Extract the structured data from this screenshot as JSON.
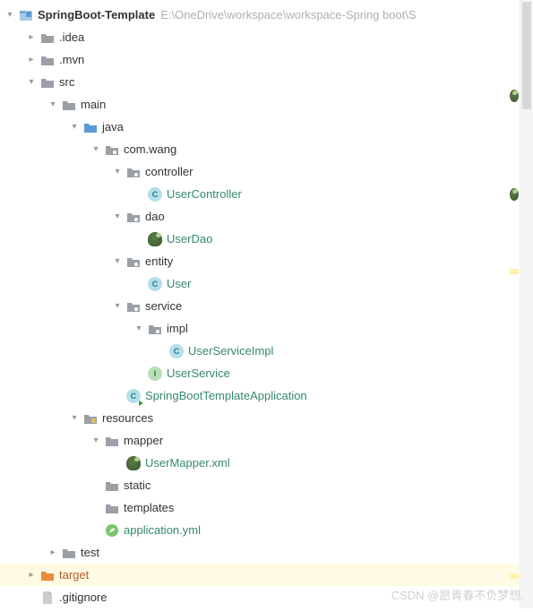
{
  "root": {
    "name": "SpringBoot-Template",
    "path": "E:\\OneDrive\\workspace\\workspace-Spring boot\\S"
  },
  "tree": {
    "idea": ".idea",
    "mvn": ".mvn",
    "src": "src",
    "main": "main",
    "java": "java",
    "pkg": "com.wang",
    "controller": "controller",
    "usercontroller": "UserController",
    "dao": "dao",
    "userdao": "UserDao",
    "entity": "entity",
    "user": "User",
    "service": "service",
    "impl": "impl",
    "userserviceimpl": "UserServiceImpl",
    "userservice": "UserService",
    "app": "SpringBootTemplateApplication",
    "resources": "resources",
    "mapper": "mapper",
    "usermapper": "UserMapper.xml",
    "static": "static",
    "templates": "templates",
    "appyml": "application.yml",
    "test": "test",
    "target": "target",
    "gitignore": ".gitignore"
  },
  "watermark": "CSDN @愿青春不负梦想."
}
